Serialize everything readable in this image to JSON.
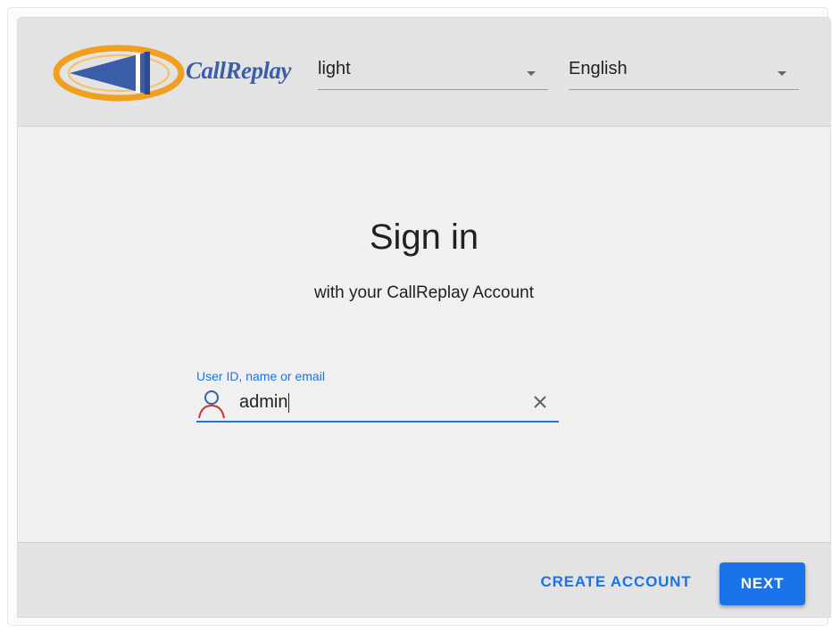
{
  "header": {
    "logo_text": "CallReplay",
    "theme_select": {
      "value": "light",
      "icon": "dropdown-caret-icon"
    },
    "language_select": {
      "value": "English",
      "icon": "dropdown-caret-icon"
    }
  },
  "main": {
    "title": "Sign in",
    "subtitle": "with your CallReplay Account",
    "user_field": {
      "label": "User ID, name or email",
      "value": "admin",
      "leading_icon": "person-icon",
      "trailing_icon": "clear-icon"
    }
  },
  "footer": {
    "create_account_label": "CREATE ACCOUNT",
    "next_label": "NEXT"
  },
  "colors": {
    "accent": "#1a73e8",
    "logo_blue": "#3a5da8",
    "logo_orange": "#f0a01e",
    "icon_red": "#c0392b"
  }
}
